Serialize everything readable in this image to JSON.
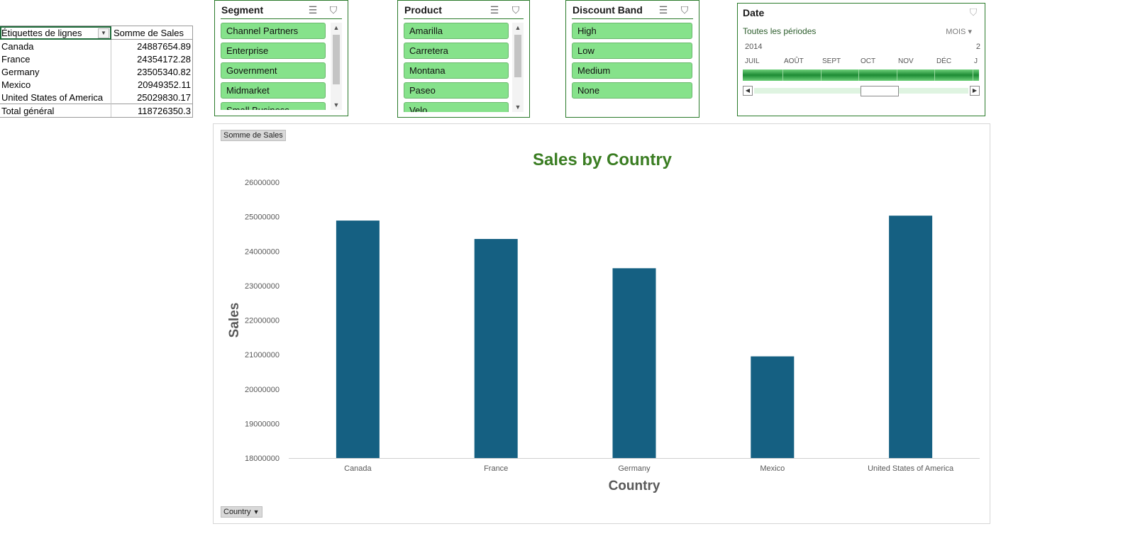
{
  "pivot": {
    "header": {
      "row_label": "Étiquettes de lignes",
      "value_label": "Somme de  Sales"
    },
    "rows": [
      {
        "label": "Canada",
        "value": "24887654.89"
      },
      {
        "label": "France",
        "value": "24354172.28"
      },
      {
        "label": "Germany",
        "value": "23505340.82"
      },
      {
        "label": "Mexico",
        "value": "20949352.11"
      },
      {
        "label": "United States of America",
        "value": "25029830.17"
      }
    ],
    "total": {
      "label": "Total général",
      "value": "118726350.3"
    }
  },
  "slicers": {
    "segment": {
      "title": "Segment",
      "items": [
        "Channel Partners",
        "Enterprise",
        "Government",
        "Midmarket",
        "Small Business"
      ]
    },
    "product": {
      "title": "Product",
      "items": [
        "Amarilla",
        "Carretera",
        "Montana",
        "Paseo",
        "Velo"
      ]
    },
    "discount": {
      "title": "Discount Band",
      "items": [
        "High",
        "Low",
        "Medium",
        "None"
      ]
    }
  },
  "timeline": {
    "title": "Date",
    "range_label": "Toutes les périodes",
    "mode": "MOIS",
    "year": "2014",
    "year_next": "2",
    "months": [
      "JUIL",
      "AOÛT",
      "SEPT",
      "OCT",
      "NOV",
      "DÉC",
      "J"
    ]
  },
  "chart": {
    "value_field_button": "Somme de Sales",
    "axis_field_button": "Country"
  },
  "chart_data": {
    "type": "bar",
    "title": "Sales by Country",
    "xlabel": "Country",
    "ylabel": "Sales",
    "categories": [
      "Canada",
      "France",
      "Germany",
      "Mexico",
      "United States of America"
    ],
    "values": [
      24887654.89,
      24354172.28,
      23505340.82,
      20949352.11,
      25029830.17
    ],
    "ylim": [
      18000000,
      26000000
    ],
    "yticks": [
      "18000000",
      "19000000",
      "20000000",
      "21000000",
      "22000000",
      "23000000",
      "24000000",
      "25000000",
      "26000000"
    ],
    "bar_color": "#156082",
    "title_color": "#3a7d22",
    "grid": false,
    "legend": "none"
  }
}
